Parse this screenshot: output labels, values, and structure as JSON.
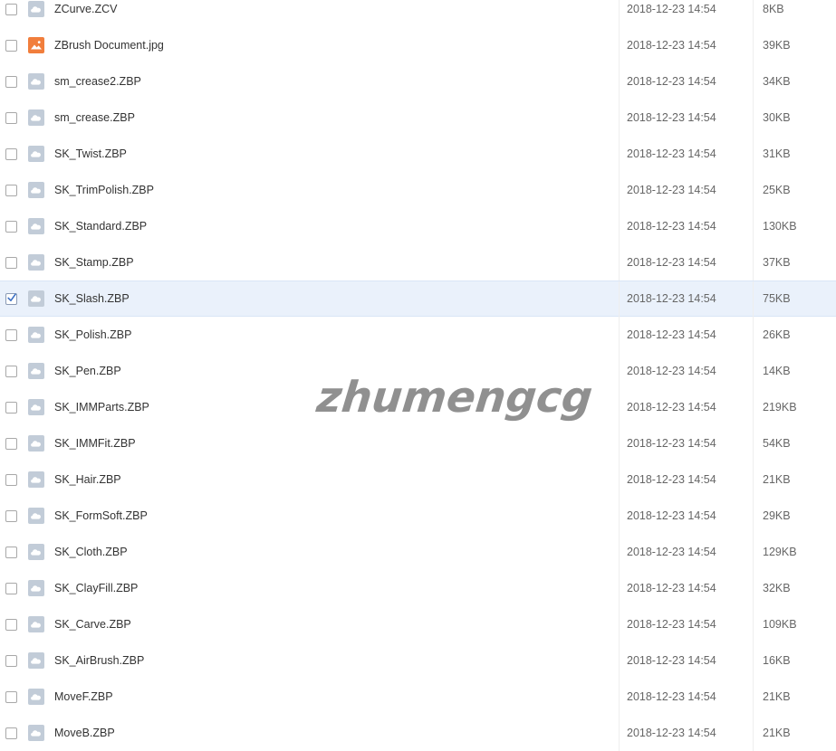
{
  "files": [
    {
      "name": "ZCurve.ZCV",
      "date": "2018-12-23 14:54",
      "size": "8KB",
      "icon": "cloud-file-icon",
      "checked": false
    },
    {
      "name": "ZBrush Document.jpg",
      "date": "2018-12-23 14:54",
      "size": "39KB",
      "icon": "image-file-icon",
      "checked": false
    },
    {
      "name": "sm_crease2.ZBP",
      "date": "2018-12-23 14:54",
      "size": "34KB",
      "icon": "cloud-file-icon",
      "checked": false
    },
    {
      "name": "sm_crease.ZBP",
      "date": "2018-12-23 14:54",
      "size": "30KB",
      "icon": "cloud-file-icon",
      "checked": false
    },
    {
      "name": "SK_Twist.ZBP",
      "date": "2018-12-23 14:54",
      "size": "31KB",
      "icon": "cloud-file-icon",
      "checked": false
    },
    {
      "name": "SK_TrimPolish.ZBP",
      "date": "2018-12-23 14:54",
      "size": "25KB",
      "icon": "cloud-file-icon",
      "checked": false
    },
    {
      "name": "SK_Standard.ZBP",
      "date": "2018-12-23 14:54",
      "size": "130KB",
      "icon": "cloud-file-icon",
      "checked": false
    },
    {
      "name": "SK_Stamp.ZBP",
      "date": "2018-12-23 14:54",
      "size": "37KB",
      "icon": "cloud-file-icon",
      "checked": false
    },
    {
      "name": "SK_Slash.ZBP",
      "date": "2018-12-23 14:54",
      "size": "75KB",
      "icon": "cloud-file-icon",
      "checked": true
    },
    {
      "name": "SK_Polish.ZBP",
      "date": "2018-12-23 14:54",
      "size": "26KB",
      "icon": "cloud-file-icon",
      "checked": false
    },
    {
      "name": "SK_Pen.ZBP",
      "date": "2018-12-23 14:54",
      "size": "14KB",
      "icon": "cloud-file-icon",
      "checked": false
    },
    {
      "name": "SK_IMMParts.ZBP",
      "date": "2018-12-23 14:54",
      "size": "219KB",
      "icon": "cloud-file-icon",
      "checked": false
    },
    {
      "name": "SK_IMMFit.ZBP",
      "date": "2018-12-23 14:54",
      "size": "54KB",
      "icon": "cloud-file-icon",
      "checked": false
    },
    {
      "name": "SK_Hair.ZBP",
      "date": "2018-12-23 14:54",
      "size": "21KB",
      "icon": "cloud-file-icon",
      "checked": false
    },
    {
      "name": "SK_FormSoft.ZBP",
      "date": "2018-12-23 14:54",
      "size": "29KB",
      "icon": "cloud-file-icon",
      "checked": false
    },
    {
      "name": "SK_Cloth.ZBP",
      "date": "2018-12-23 14:54",
      "size": "129KB",
      "icon": "cloud-file-icon",
      "checked": false
    },
    {
      "name": "SK_ClayFill.ZBP",
      "date": "2018-12-23 14:54",
      "size": "32KB",
      "icon": "cloud-file-icon",
      "checked": false
    },
    {
      "name": "SK_Carve.ZBP",
      "date": "2018-12-23 14:54",
      "size": "109KB",
      "icon": "cloud-file-icon",
      "checked": false
    },
    {
      "name": "SK_AirBrush.ZBP",
      "date": "2018-12-23 14:54",
      "size": "16KB",
      "icon": "cloud-file-icon",
      "checked": false
    },
    {
      "name": "MoveF.ZBP",
      "date": "2018-12-23 14:54",
      "size": "21KB",
      "icon": "cloud-file-icon",
      "checked": false
    },
    {
      "name": "MoveB.ZBP",
      "date": "2018-12-23 14:54",
      "size": "21KB",
      "icon": "cloud-file-icon",
      "checked": false
    }
  ],
  "watermark": "zhumengcg",
  "colors": {
    "selected_row_bg": "#eaf1fb",
    "generic_icon": "#c2ccd8",
    "image_icon": "#f17e3c",
    "check_tick": "#3b6fc4"
  }
}
